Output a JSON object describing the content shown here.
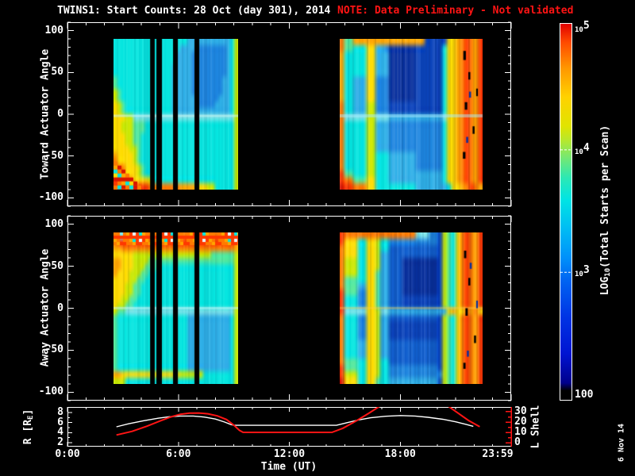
{
  "meta": {
    "title": "TWINS1: Start Counts: 28 Oct (day 301), 2014",
    "note": "NOTE: Data Preliminary - Not validated",
    "datestamp": "6 Nov 14",
    "title_color": "#ffffff",
    "note_color": "#ff1414",
    "frame_color": "#ffffff",
    "l_shell_color": "#ff1414",
    "background": "#000000"
  },
  "chart_data": {
    "type": "heatmap",
    "title": "TWINS1: Start Counts: 28 Oct (day 301), 2014",
    "x_axis": {
      "label": "Time (UT)",
      "range_hours": [
        0,
        24
      ],
      "major_tick_hours": [
        0,
        6,
        12,
        18,
        24
      ],
      "major_tick_labels": [
        "0:00",
        "6:00",
        "12:00",
        "18:00",
        "23:59"
      ],
      "minor_step_hours": 1
    },
    "heat_panels": [
      {
        "ylabel": "Toward Actuator Angle",
        "y_range": [
          -110,
          110
        ],
        "y_major": [
          -100,
          -50,
          0,
          50,
          100
        ],
        "y_minor_step": 10
      },
      {
        "ylabel": "Away Actuator Angle",
        "y_range": [
          -110,
          110
        ],
        "y_major": [
          -100,
          -50,
          0,
          50,
          100
        ],
        "y_minor_step": 10
      }
    ],
    "colorbar": {
      "label_pre": "LOG",
      "label_sub": "10",
      "label_post": "(Total Starts per Scan)",
      "scale": "log",
      "range": [
        100,
        100000
      ],
      "ticks": [
        {
          "base": "10",
          "exp": "5",
          "frac": 0.99
        },
        {
          "base": "10",
          "exp": "4",
          "frac": 0.656
        },
        {
          "base": "10",
          "exp": "3",
          "frac": 0.322
        },
        {
          "text": "100",
          "frac": -0.012
        }
      ],
      "dash_fracs": [
        0.656,
        0.322
      ],
      "stops": [
        [
          0.0,
          "#000006"
        ],
        [
          0.02,
          "#00008c"
        ],
        [
          0.1,
          "#0014d2"
        ],
        [
          0.2,
          "#0034e4"
        ],
        [
          0.3,
          "#0064f2"
        ],
        [
          0.36,
          "#0090fa"
        ],
        [
          0.44,
          "#00bcf4"
        ],
        [
          0.52,
          "#00e4e4"
        ],
        [
          0.58,
          "#2ce8b4"
        ],
        [
          0.64,
          "#7ce86c"
        ],
        [
          0.68,
          "#b4e830"
        ],
        [
          0.72,
          "#e0e400"
        ],
        [
          0.8,
          "#ffd200"
        ],
        [
          0.88,
          "#ff9600"
        ],
        [
          0.95,
          "#ff4a00"
        ],
        [
          1.0,
          "#e00000"
        ]
      ]
    },
    "ephemeris_panel": {
      "left_label_pre": "R [R",
      "left_label_sub": "E",
      "left_label_post": "]",
      "right_label": "L Shell",
      "r_axis": {
        "range": [
          1.2,
          9.1
        ],
        "major": [
          8,
          6,
          4,
          2
        ],
        "minor": [
          9,
          7,
          5,
          3
        ]
      },
      "l_axis": {
        "range": [
          -3.8,
          34.6
        ],
        "major": [
          30,
          20,
          10,
          0
        ],
        "minor": [
          25,
          15,
          5
        ]
      },
      "r_series": [
        [
          2.65,
          5.15
        ],
        [
          3.3,
          5.75
        ],
        [
          4.1,
          6.35
        ],
        [
          4.9,
          6.85
        ],
        [
          5.5,
          7.15
        ],
        [
          6.1,
          7.3
        ],
        [
          6.8,
          7.3
        ],
        [
          7.4,
          7.1
        ],
        [
          8.0,
          6.7
        ],
        [
          8.5,
          6.1
        ],
        [
          8.85,
          5.6
        ],
        [
          9.0,
          5.45
        ],
        [
          14.55,
          5.45
        ],
        [
          15.1,
          5.95
        ],
        [
          15.7,
          6.5
        ],
        [
          16.4,
          6.95
        ],
        [
          17.2,
          7.25
        ],
        [
          18.0,
          7.4
        ],
        [
          18.8,
          7.3
        ],
        [
          19.5,
          7.05
        ],
        [
          20.3,
          6.65
        ],
        [
          21.0,
          6.15
        ],
        [
          21.6,
          5.6
        ],
        [
          21.95,
          5.25
        ]
      ],
      "l_series": [
        [
          [
            2.65,
            7.5
          ],
          [
            3.5,
            11
          ],
          [
            4.3,
            16
          ],
          [
            5.0,
            21
          ],
          [
            5.6,
            25
          ],
          [
            6.1,
            27.5
          ],
          [
            6.6,
            28.6
          ],
          [
            7.1,
            28.8
          ],
          [
            7.6,
            28
          ],
          [
            8.1,
            26
          ],
          [
            8.6,
            22.5
          ],
          [
            9.0,
            17
          ],
          [
            9.3,
            12
          ],
          [
            9.5,
            10
          ],
          [
            14.3,
            10
          ],
          [
            14.9,
            14
          ],
          [
            15.6,
            21
          ],
          [
            16.3,
            28.5
          ],
          [
            16.95,
            36
          ]
        ],
        [
          [
            20.55,
            36
          ],
          [
            21.1,
            29
          ],
          [
            21.7,
            21.5
          ],
          [
            22.3,
            15.5
          ]
        ]
      ]
    },
    "heatmap": {
      "deg_range": [
        90,
        -90
      ],
      "palette": {
        "k": "#000000",
        "R": "#d81400",
        "r": "#ff3800",
        "o": "#ff7a00",
        "O": "#ffa600",
        "y": "#ffdc00",
        "Y": "#c8e800",
        "G": "#52e89c",
        "c": "#06e6e0",
        "C": "#7ae4ea",
        "s": "#2fb0e8",
        "b": "#1e86e0",
        "B": "#1160d0",
        "n": "#0b44bc",
        "N": "#08309e",
        "w": "#b8eef4"
      },
      "gaps_t": [
        [
          4.47,
          4.72
        ],
        [
          4.81,
          5.11
        ],
        [
          5.71,
          5.97
        ],
        [
          6.87,
          7.13
        ]
      ],
      "blocks": [
        {
          "panel": 0,
          "t_range": [
            2.49,
            9.23
          ],
          "tex": 0.16,
          "rows": [
            "cccccccccccccccccccssssssssssscY",
            "cccccccccccccccccssssbbbbbbbbscY",
            "ccccccccccccccccssssbbbbbbbbbscY",
            "ccccccccccccccccssssbbbbbbbbbscY",
            "cccccccccccccccsssssbbbbbbbbbscY",
            "cccccccccccccccsssssbbbbbbbbbscY",
            "GccccccccccccccsssssbbbbbbbbsscY",
            "GccccccccccccccsssssbbbbbbbbsscY",
            "YGcccccccccccccsssssbbbbbbbbsscY",
            "YGcccccccccccccssssssbbbbbbssscY",
            "yYGccccccccccccssssssbbbbbsssscY",
            "yYGccccccccccccssssssssssssssscY",
            "yyyYYCCCCCCCCCCCCCCCCCCCCCCCCCCY",
            "yyYYYGGGcccccccccccccccccccccccY",
            "yyYYYGGGcccccccccccccccccccccccY",
            "yyyYYGGccccccccccccccccccccccccY",
            "yyyYYGGccccccccccccccccccccccccY",
            "yyyyYYGccccccccccccccccccccccccY",
            "OyyyyYGccccccccccccccccccccccccY",
            "oyyyyYGccccccccccccccccccccccccY",
            "oooyyyYGcccccccccccccccccccccccY",
            "oooyyyYGcccccccccccccccccccccccY",
            "rroooyyyyYcccccccccccccccccccccY",
            "RRrrrrrrrooooooooOOOOyyyYYcccccY"
          ]
        },
        {
          "panel": 0,
          "t_range": [
            14.73,
            22.45
          ],
          "tex": 0.26,
          "rows": [
            "oGGOOOOOOOOOOOOOOOOnnnnnyyOoroOr",
            "oGGcccyyssbNNNNNNnnnnnncyyOoroOr",
            "OcccccyysssNNNNNNnnnnnncyyOoroOr",
            "OcccccyysssNNNNNNnnnnnncyyOoroOr",
            "OcccccyysssNNNNNNnnnnnncyyOoroOr",
            "OcccccyysssNNNNNNnnnnnncyyOoroOr",
            "OccsssyybbbNNNNNNnnnnnncyyOoroOr",
            "OccsssyybbbNNNNNNnnnnnncyyOoroOr",
            "OccsssyybbbNNNNNNnnnnnncyyOoroOr",
            "OccsssyybbbNNNNNNnnnnnncyyOoroOr",
            "occsssYYbbbnnnnnnnnnnnncyyOoroOr",
            "occsssYYbbbnnnnnnnnnnnncyyOoroOr",
            "oCCCCCYYCCCssssssssssssCyyOoroOr",
            "occcccYYsssbbbbbbbbbbbbcyyOoroOr",
            "occcccYYsssbbbbbbbbbbbbcyyOoroOr",
            "occcccYYsssbbbbbbbbbbbbcyyOoroOr",
            "occcccYYsssbbbbbbbbbbbbcyyOoroOr",
            "occcccYYsssbbbbbbbbbbbbcyyOoroOr",
            "occcccYYcccssssssbbbbbbcyyOoroOr",
            "occcccYYcccssssssbbbbbbcyyOoroOr",
            "occcccYYcccssssssbbbbbbcyyOoroOr",
            "rGGcccYYcccsssssssssssscyyOoroOr",
            "rooGGGyycccsssssssssssscyyOoroOr",
            "RrroooyycccccccccssssssscyyOoroOr"
          ]
        },
        {
          "panel": 1,
          "t_range": [
            2.49,
            9.23
          ],
          "tex": 0.16,
          "rows": [
            "CCCooooooooooooooooooooooooooooO",
            "orrrrrrrrrrrrrrrrrrrrrrrrrrrrrrO",
            "OOoooooooooooooooooooooooooooooO",
            "yyyyyYYYYYYYYYYYYYYYYYYYYGGGGGGY",
            "OOyyyYYYYGGGGGGGGGGGGGGGGGGGGGGY",
            "OOyyyYYYGGGccccccccccccccccccccY",
            "OyyyYYYGGccccccccccccccccccccccY",
            "yyyyYYGGcccccccccccccccccccccccY",
            "yyyYYGGccccccccccccccccccccccccY",
            "yyyYYGGccccccccccccccccccccccccY",
            "yyYYGGcccccccccccccccccccccccccY",
            "yYYGGccccccccccccccccccccccccccY",
            "YGGCCCCCCCCCCCCCCCCCCCCCCCCCCCCY",
            "GccccccccccccccccccssssssssssscY",
            "GccccccccccccccccccssssssssssscY",
            "GccccccccccccccccccssssssssssscY",
            "GccccccccccccccccccssssssssssscY",
            "GccccccccccccccccccssssssssssscY",
            "GccccccccccccccccccssssssssssscY",
            "GccccccccccccccccccssssssssssscY",
            "GccccccccccccccccccssssssssssscY",
            "GccccccccccccccccccssssssssssscY",
            "OOyyyyyyyyyyyyyyyYYYYYYccccccccY",
            "YYYccccccccccccccccccccccccccccY"
          ]
        },
        {
          "panel": 1,
          "t_range": [
            14.73,
            22.45
          ],
          "tex": 0.26,
          "rows": [
            "rooooooooooooooooCCCbbnYGcyoroOr",
            "ryyyccyyYccbbbbbbbbbbbnYGcyoroOr",
            "oyyyccyyYccBBBBBBBBBBBnYGcyoroOr",
            "oyyyccyyYssBBBBBBBBBBBnYGcyoroOr",
            "oYYYccyyYssBBBNNNNNNNNnYGcyoroOr",
            "oYYYccyyYssBBBNNNNNNNNnYGcyoroOr",
            "oYYYccyyGssBBBNNNNNNNNnYGcyoroOr",
            "oGGGccyyGssBBBNNNNNNNNnYGcyoroOr",
            "oGGGssyyGssBBBNNNNNNNNnYGcyoroOr",
            "rGGGbbyyGssBBBNNNNNNNNnYGcyoroOr",
            "rcccbbyyGssBBBnnnnnnnnnYGcyoroOr",
            "rcccbbyyGssBBBnnnnnnnnnYGcyoroOr",
            "rCCCCCyyYCCsssssssssssssyOyyoOoyr",
            "occcbbyyYssBBBBBBBBBBBnYGcyoroOr",
            "occcbbyyYssnnnnnnnnnnnnYGcyoroOr",
            "occcbbyyYssnnnnnnnnnnnnYGcyoroOr",
            "occcbbyyYssnnnnnnnnnnnnYGcyoroOr",
            "occcssyyYssBBBBBBBBBBBnYGcyoroOr",
            "occcssyyYssBBBBBBBBBBBnYGcyoroOr",
            "occcssyyYssBBBBBBBBBBBnYGcyoroOr",
            "oGGGccyyYccBBBBBBBBBBBnYGcyoroOr",
            "rGGGccyyYccbbbbbbbbbbbnYGcyoroOr",
            "rYYYccyyYccbbbbbbbbbbbbYGcyoroOr",
            "RyyyccyyGccsssssssssssnYGcyoroOr"
          ]
        }
      ],
      "light_lines": [
        {
          "block": 0,
          "deg": -2,
          "h": 3,
          "color": "rgba(205,250,242,0.55)"
        },
        {
          "block": 1,
          "deg": -2,
          "h": 4,
          "color": "rgba(170,240,255,0.50)"
        },
        {
          "block": 2,
          "deg": 0,
          "h": 3,
          "color": "rgba(205,250,250,0.50)"
        },
        {
          "block": 3,
          "deg": 0,
          "h": 3,
          "color": "rgba(255,205,80,0.38)"
        }
      ],
      "checkers": [
        {
          "block": 0,
          "t": [
            2.49,
            4.15
          ],
          "deg": [
            -52,
            -90
          ],
          "cell": 5,
          "wedge": true,
          "colors": [
            "#ff3800",
            "#ff7a00",
            "#ffa600",
            "#06e6e0",
            "#ffdc00",
            "#d81400"
          ]
        },
        {
          "block": 2,
          "t": [
            2.49,
            9.23
          ],
          "deg": [
            90,
            76
          ],
          "cell": 4,
          "wedge": false,
          "colors": [
            "#ff7a00",
            "#ff3800",
            "#ffa600",
            "#ff7a00",
            "#06e6e0",
            "#ff3800",
            "",
            "#ffa600",
            "#e8fcff",
            "#ff7a00"
          ]
        }
      ],
      "dashes": [
        {
          "block": 1,
          "color": "#000000",
          "items": [
            [
              0.865,
              0.08,
              0.018,
              0.06
            ],
            [
              0.9,
              0.22,
              0.014,
              0.05
            ],
            [
              0.875,
              0.42,
              0.018,
              0.05
            ],
            [
              0.93,
              0.58,
              0.014,
              0.05
            ],
            [
              0.862,
              0.75,
              0.018,
              0.045
            ],
            [
              0.955,
              0.33,
              0.012,
              0.05
            ]
          ]
        },
        {
          "block": 1,
          "color": "#08309e",
          "items": [
            [
              0.905,
              0.35,
              0.014,
              0.04
            ],
            [
              0.885,
              0.65,
              0.014,
              0.04
            ]
          ]
        },
        {
          "block": 3,
          "color": "#000000",
          "items": [
            [
              0.87,
              0.12,
              0.016,
              0.05
            ],
            [
              0.9,
              0.3,
              0.014,
              0.05
            ],
            [
              0.88,
              0.5,
              0.016,
              0.05
            ],
            [
              0.94,
              0.68,
              0.014,
              0.05
            ],
            [
              0.865,
              0.86,
              0.016,
              0.04
            ]
          ]
        },
        {
          "block": 3,
          "color": "#08309e",
          "items": [
            [
              0.91,
              0.2,
              0.014,
              0.04
            ],
            [
              0.89,
              0.78,
              0.014,
              0.04
            ],
            [
              0.955,
              0.45,
              0.012,
              0.05
            ]
          ]
        }
      ]
    }
  }
}
